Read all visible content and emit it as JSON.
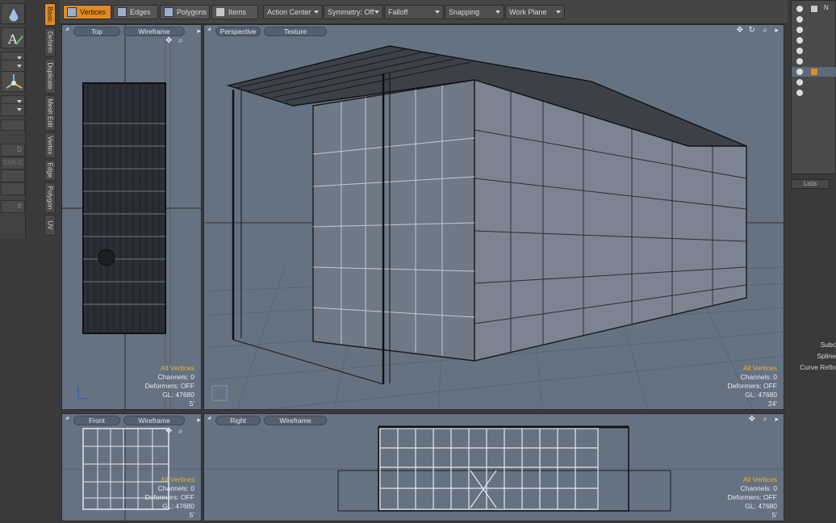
{
  "toolbar": {
    "vertices": "Vertices",
    "edges": "Edges",
    "polygons": "Polygons",
    "items": "Items",
    "action_center": "Action Center",
    "symmetry": "Symmetry: Off",
    "falloff": "Falloff",
    "snapping": "Snapping",
    "work_plane": "Work Plane"
  },
  "vertical_tabs": [
    "Basic",
    "Deform",
    "Duplicate",
    "Mesh Edit",
    "Vertex",
    "Edge",
    "Polygon",
    "UV"
  ],
  "left_tools": {
    "shortcut_shift_c": "Shift-C",
    "key_d": "D",
    "key_b": "B"
  },
  "viewports": {
    "top": {
      "view": "Top",
      "shading": "Wireframe",
      "sel": "All Vertices",
      "channels": "Channels: 0",
      "deformers": "Deformers: OFF",
      "gl": "GL: 47680",
      "scale": "5'"
    },
    "perspective": {
      "view": "Perspective",
      "shading": "Texture",
      "sel": "All Vertices",
      "channels": "Channels: 0",
      "deformers": "Deformers: OFF",
      "gl": "GL: 47680",
      "scale": "24'"
    },
    "front": {
      "view": "Front",
      "shading": "Wireframe",
      "sel": "All Vertices",
      "channels": "Channels: 0",
      "deformers": "Deformers: OFF",
      "gl": "GL: 47680",
      "scale": "5'"
    },
    "right": {
      "view": "Right",
      "shading": "Wireframe",
      "sel": "All Vertices",
      "channels": "Channels: 0",
      "deformers": "Deformers: OFF",
      "gl": "GL: 47680",
      "scale": "5'"
    }
  },
  "right_panel": {
    "lists_tab": "Lists",
    "labels": [
      "Subc",
      "Spline",
      "Curve Refin"
    ],
    "header_letter": "N"
  },
  "colors": {
    "accent": "#e38a22",
    "viewport_bg": "#657282",
    "selection_text": "#f0b030"
  }
}
